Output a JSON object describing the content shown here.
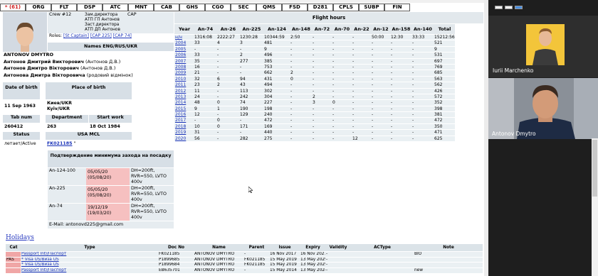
{
  "nav": {
    "alert": "* (61)",
    "tabs": [
      "ORG",
      "FLT",
      "DSP",
      "ATC",
      "MNT",
      "CAB",
      "GHS",
      "CGO",
      "SEC",
      "QMS",
      "FSD",
      "D281",
      "CPLS",
      "SUBP",
      "FIN"
    ]
  },
  "profile": {
    "crew": "Crew #12",
    "cap": "CAP",
    "positions": [
      "Зам.директора",
      "АТП ГП Антонов",
      "Заст.директора",
      "АТП ДП Антонов"
    ],
    "roles_label": "Roles:",
    "roles": [
      "[St Captain]",
      "[CAP 225]",
      "[CAP 74]"
    ],
    "names_header": "Names ENG/RUS/UKR",
    "name_en": "ANTONOV DMYTRO",
    "name_ru": "Антонов Дмитрий Викторович",
    "name_ru_note": "(Антонов Д.В.)",
    "name_uk": "Антонов Дмитро Вікторович",
    "name_uk_note": "(Антонов Д.В.)",
    "name_uk2": "Антонова Дмитра Вікторовича",
    "name_uk2_note": "(родовий відмінок)",
    "dob_label": "Date of birth",
    "pob_label": "Place of birth",
    "dob": "11 Sep 1963",
    "pob": "Киев/UKR Kyiv/UKR",
    "tab_label": "Tab num",
    "dept_label": "Department",
    "start_label": "Start work",
    "tab": "260412",
    "dept": "263",
    "start": "18 Oct 1984",
    "status_label": "Status",
    "mcl_label": "USA MCL",
    "status": "летает/Active",
    "mcl": "FK021185",
    "mcl_suffix": "\"",
    "minima_header": "Подтверждение минимума захода на посадку",
    "minima": [
      {
        "type": "An-124-100",
        "date": "05/05/20",
        "date2": "(05/08/20)",
        "wx": "DH=200ft, RVR=550, LVTO 400v"
      },
      {
        "type": "An-225",
        "date": "05/05/20",
        "date2": "(05/08/20)",
        "wx": "DH=200ft, RVR=550, LVTO 400v"
      },
      {
        "type": "An-74",
        "date": "19/12/19",
        "date2": "(19/03/20)",
        "wx": "DH=200ft, RVR=550, LVTO 400v"
      }
    ],
    "email": "E-Mail: antonovd225@gmail.com"
  },
  "flight": {
    "title": "Flight hours",
    "columns": [
      "Year",
      "An-74",
      "An-26",
      "An-225",
      "An-124",
      "An-148",
      "An-72",
      "An-70",
      "An-22",
      "An-12",
      "An-158",
      "An-140",
      "Total"
    ],
    "rows": [
      [
        "н/н",
        "1316:08",
        "2222:27",
        "1230:28",
        "10344:59",
        "2:50",
        "-",
        "-",
        "-",
        "50:00",
        "12:30",
        "33:33",
        "15212:56"
      ],
      [
        "2004",
        "33",
        "4",
        "3",
        "481",
        "-",
        "-",
        "-",
        "-",
        "-",
        "-",
        "-",
        "521"
      ],
      [
        "2005",
        "-",
        "-",
        "-",
        "9",
        "-",
        "-",
        "-",
        "-",
        "-",
        "-",
        "-",
        "9"
      ],
      [
        "2006",
        "33",
        "-",
        "2",
        "496",
        "-",
        "-",
        "-",
        "-",
        "-",
        "-",
        "-",
        "531"
      ],
      [
        "2007",
        "35",
        "-",
        "277",
        "385",
        "-",
        "-",
        "-",
        "-",
        "-",
        "-",
        "-",
        "697"
      ],
      [
        "2008",
        "16",
        "-",
        "-",
        "753",
        "-",
        "-",
        "-",
        "-",
        "-",
        "-",
        "-",
        "769"
      ],
      [
        "2009",
        "21",
        "-",
        "-",
        "662",
        "2",
        "-",
        "-",
        "-",
        "-",
        "-",
        "-",
        "685"
      ],
      [
        "2010",
        "32",
        "6",
        "94",
        "431",
        "0",
        "-",
        "-",
        "-",
        "-",
        "-",
        "-",
        "563"
      ],
      [
        "2011",
        "23",
        "2",
        "43",
        "494",
        "-",
        "-",
        "-",
        "-",
        "-",
        "-",
        "-",
        "562"
      ],
      [
        "2012",
        "11",
        "-",
        "113",
        "302",
        "-",
        "-",
        "-",
        "-",
        "-",
        "-",
        "-",
        "426"
      ],
      [
        "2013",
        "24",
        "-",
        "242",
        "304",
        "-",
        "2",
        "-",
        "-",
        "-",
        "-",
        "-",
        "572"
      ],
      [
        "2014",
        "48",
        "0",
        "74",
        "227",
        "-",
        "3",
        "0",
        "-",
        "-",
        "-",
        "-",
        "352"
      ],
      [
        "2015",
        "9",
        "1",
        "190",
        "198",
        "-",
        "-",
        "-",
        "-",
        "-",
        "-",
        "-",
        "398"
      ],
      [
        "2016",
        "12",
        "-",
        "129",
        "240",
        "-",
        "-",
        "-",
        "-",
        "-",
        "-",
        "-",
        "381"
      ],
      [
        "2017",
        "-",
        "0",
        "-",
        "472",
        "-",
        "-",
        "-",
        "-",
        "-",
        "-",
        "-",
        "472"
      ],
      [
        "2018",
        "10",
        "0",
        "171",
        "169",
        "-",
        "-",
        "-",
        "-",
        "-",
        "-",
        "-",
        "350"
      ],
      [
        "2019",
        "31",
        "-",
        "-",
        "440",
        "-",
        "-",
        "-",
        "-",
        "-",
        "-",
        "-",
        "471"
      ],
      [
        "2020",
        "56",
        "-",
        "282",
        "275",
        "-",
        "-",
        "-",
        "12",
        "-",
        "-",
        "-",
        "625"
      ]
    ]
  },
  "participants": [
    {
      "name": "Iurii Marchenko"
    },
    {
      "name": "Antonov Dmytro"
    }
  ],
  "holidays": {
    "title": "Holidays"
  },
  "documents": {
    "columns": [
      "Cat",
      "Type",
      "Doc No",
      "Name",
      "Parent",
      "Issue",
      "Expiry",
      "Validity",
      "ACType",
      "Note"
    ],
    "cat": "PAS",
    "rows": [
      [
        "Passport Intl/Паспорт",
        "FK021185",
        "ANTONOV DMYTRO",
        "-",
        "16 Nov 2017",
        "16 Nov 2027",
        "-",
        "",
        "BIO"
      ],
      [
        "* Visa US/Виза US",
        "P1899685",
        "ANTONOV DMYTRO",
        "FK021185",
        "15 May 2019",
        "13 May 2029",
        "-",
        "",
        ""
      ],
      [
        "* Visa US/Виза US",
        "P1899684",
        "ANTONOV DMYTRO",
        "FK021185",
        "15 May 2019",
        "13 May 2029",
        "-",
        "",
        ""
      ],
      [
        "Passport Intl/Паспорт",
        "EB635701",
        "ANTONOV DMYTRO",
        "-",
        "15 May 2014",
        "13 May 2024",
        "-",
        "",
        "new"
      ]
    ]
  }
}
